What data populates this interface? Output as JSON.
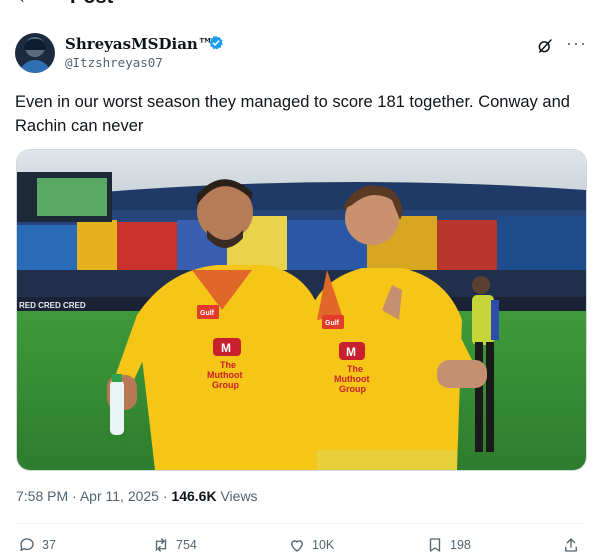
{
  "header": {
    "back_icon": "back-arrow-icon",
    "title": "Post"
  },
  "author": {
    "display_name": "ShreyasMSDian™",
    "handle": "@Itzshreyas07",
    "verified": true,
    "verified_color": "#1d9bf0"
  },
  "tweet": {
    "text": "Even in our worst season they managed to score 181 together. Conway and Rachin can never",
    "media_texts": {
      "jersey_left_logo": "M",
      "jersey_left_line1": "The",
      "jersey_left_line2": "Muthoot",
      "jersey_left_line3": "Group",
      "jersey_right_logo": "M",
      "jersey_right_line1": "The",
      "jersey_right_line2": "Muthoot",
      "jersey_right_line3": "Group",
      "sponsor_patch": "Gulf",
      "board_text": "RED  CRED  CRED"
    }
  },
  "meta": {
    "time": "7:58 PM",
    "separator": "·",
    "date": "Apr 11, 2025",
    "views_count": "146.6K",
    "views_label": "Views"
  },
  "actions": {
    "replies": "37",
    "reposts": "754",
    "likes": "10K",
    "bookmarks": "198"
  },
  "colors": {
    "text": "#0f1419",
    "secondary": "#536471",
    "jersey": "#f5c518",
    "accent": "#1d9bf0"
  }
}
